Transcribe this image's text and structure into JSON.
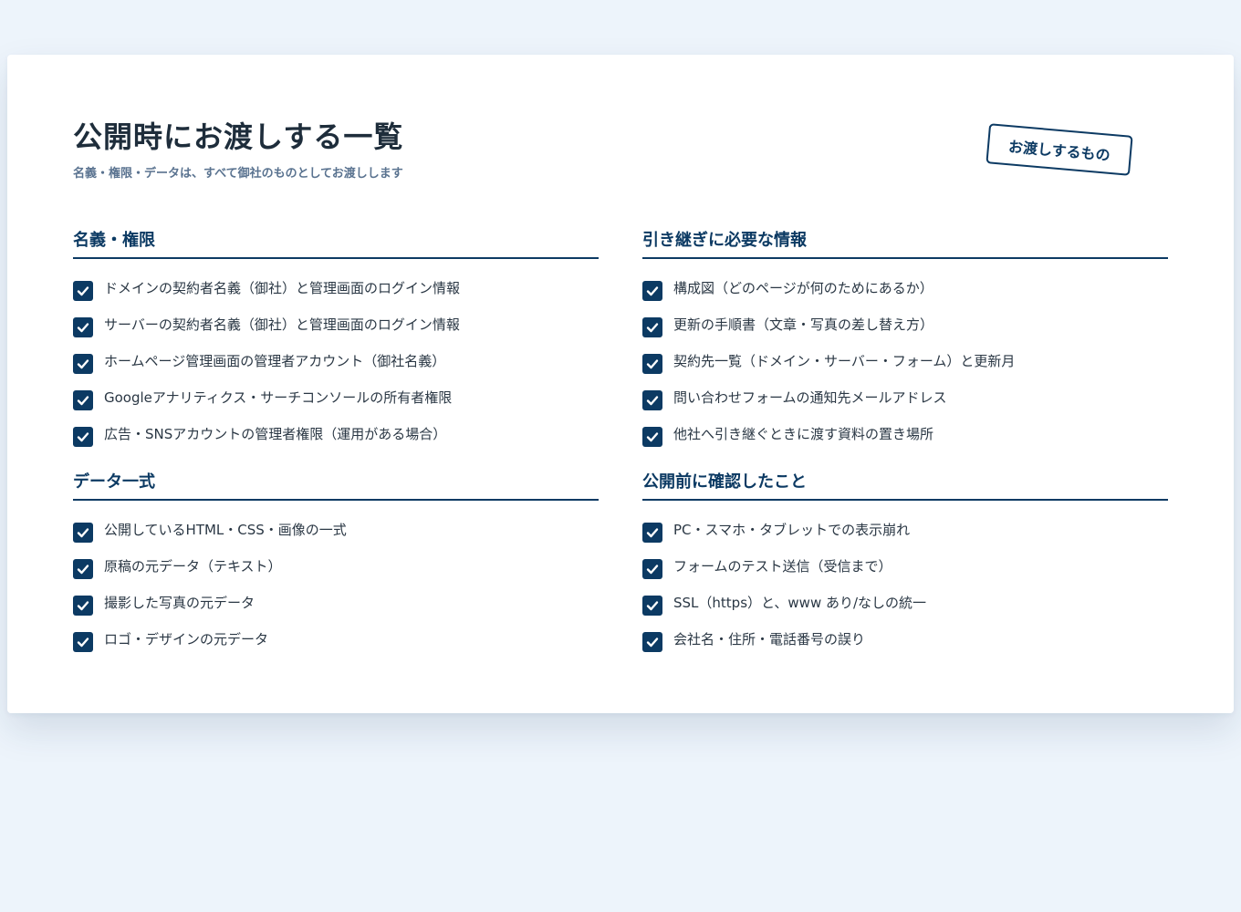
{
  "page": {
    "title": "公開時にお渡しする一覧",
    "subtitle": "名義・権限・データは、すべて御社のものとしてお渡しします",
    "stamp": "お渡しするもの"
  },
  "sections": {
    "ownership": {
      "title": "名義・権限",
      "items": [
        "ドメインの契約者名義（御社）と管理画面のログイン情報",
        "サーバーの契約者名義（御社）と管理画面のログイン情報",
        "ホームページ管理画面の管理者アカウント（御社名義）",
        "Googleアナリティクス・サーチコンソールの所有者権限",
        "広告・SNSアカウントの管理者権限（運用がある場合）"
      ]
    },
    "handover": {
      "title": "引き継ぎに必要な情報",
      "items": [
        "構成図（どのページが何のためにあるか）",
        "更新の手順書（文章・写真の差し替え方）",
        "契約先一覧（ドメイン・サーバー・フォーム）と更新月",
        "問い合わせフォームの通知先メールアドレス",
        "他社へ引き継ぐときに渡す資料の置き場所"
      ]
    },
    "data": {
      "title": "データ一式",
      "items": [
        "公開しているHTML・CSS・画像の一式",
        "原稿の元データ（テキスト）",
        "撮影した写真の元データ",
        "ロゴ・デザインの元データ"
      ]
    },
    "checks": {
      "title": "公開前に確認したこと",
      "items": [
        "PC・スマホ・タブレットでの表示崩れ",
        "フォームのテスト送信（受信まで）",
        "SSL（https）と、www あり/なしの統一",
        "会社名・住所・電話番号の誤り"
      ]
    }
  },
  "icons": {
    "check": "checkbox-checked-icon"
  },
  "colors": {
    "accent": "#0c3a63",
    "background": "#edf4fb",
    "card": "#ffffff",
    "subtitle": "#5a7390"
  }
}
